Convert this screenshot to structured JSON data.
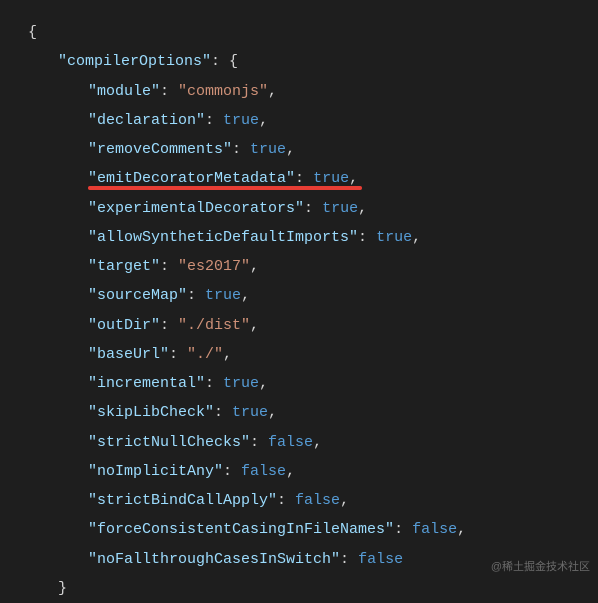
{
  "code": {
    "rootKey": "compilerOptions",
    "entries": [
      {
        "key": "module",
        "type": "string",
        "value": "commonjs"
      },
      {
        "key": "declaration",
        "type": "bool",
        "value": "true"
      },
      {
        "key": "removeComments",
        "type": "bool",
        "value": "true"
      },
      {
        "key": "emitDecoratorMetadata",
        "type": "bool",
        "value": "true",
        "highlighted": true
      },
      {
        "key": "experimentalDecorators",
        "type": "bool",
        "value": "true"
      },
      {
        "key": "allowSyntheticDefaultImports",
        "type": "bool",
        "value": "true"
      },
      {
        "key": "target",
        "type": "string",
        "value": "es2017"
      },
      {
        "key": "sourceMap",
        "type": "bool",
        "value": "true"
      },
      {
        "key": "outDir",
        "type": "string",
        "value": "./dist"
      },
      {
        "key": "baseUrl",
        "type": "string",
        "value": "./"
      },
      {
        "key": "incremental",
        "type": "bool",
        "value": "true"
      },
      {
        "key": "skipLibCheck",
        "type": "bool",
        "value": "true"
      },
      {
        "key": "strictNullChecks",
        "type": "bool",
        "value": "false"
      },
      {
        "key": "noImplicitAny",
        "type": "bool",
        "value": "false"
      },
      {
        "key": "strictBindCallApply",
        "type": "bool",
        "value": "false"
      },
      {
        "key": "forceConsistentCasingInFileNames",
        "type": "bool",
        "value": "false"
      },
      {
        "key": "noFallthroughCasesInSwitch",
        "type": "bool",
        "value": "false"
      }
    ]
  },
  "watermark": "@稀土掘金技术社区"
}
